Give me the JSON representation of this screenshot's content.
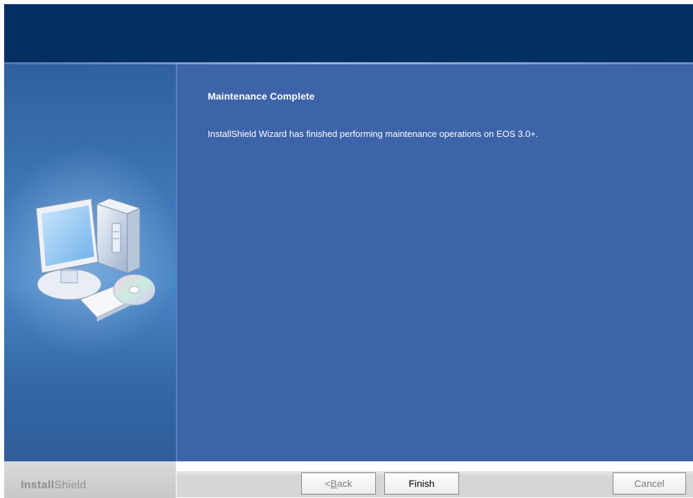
{
  "wizard": {
    "heading": "Maintenance Complete",
    "message": "InstallShield Wizard has finished performing maintenance operations on EOS 3.0+."
  },
  "footer": {
    "brand_part1": "Install",
    "brand_part2": "Shield",
    "back_prefix": "< ",
    "back_mnemonic": "B",
    "back_rest": "ack",
    "finish_label": "Finish",
    "cancel_label": "Cancel"
  },
  "colors": {
    "banner": "#023062",
    "panel": "#3d63a9",
    "sidepanel": "#3c74b4",
    "button_bar": "#d6d6d6"
  },
  "icons": {
    "side_graphic": "computer-with-cd-icon"
  }
}
